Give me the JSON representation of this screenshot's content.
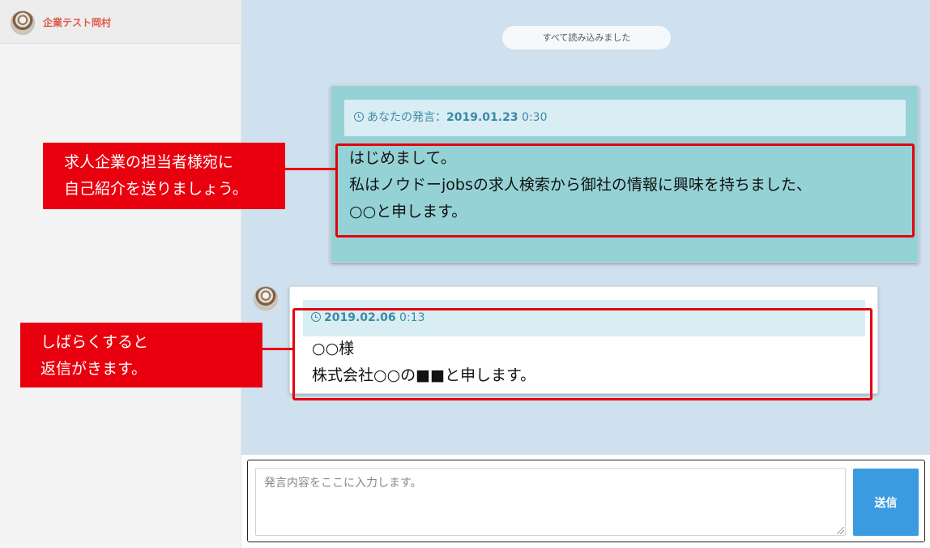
{
  "sidebar": {
    "company_name": "企業テスト岡村"
  },
  "chat": {
    "load_status": "すべて読み込みました",
    "messages": [
      {
        "author": "mine",
        "meta_prefix": "あなたの発言：",
        "date": "2019.01.23",
        "time": "0:30",
        "lines": [
          "はじめまして。",
          "私はノウドーjobsの求人検索から御社の情報に興味を持ちました、",
          "○○と申します。"
        ]
      },
      {
        "author": "company",
        "date": "2019.02.06",
        "time": "0:13",
        "lines": [
          "○○様",
          "株式会社○○の■■と申します。"
        ]
      }
    ]
  },
  "composer": {
    "placeholder": "発言内容をここに入力します。",
    "send_label": "送信"
  },
  "annotations": [
    {
      "lines": [
        "求人企業の担当者様宛に",
        "自己紹介を送りましょう。"
      ]
    },
    {
      "lines": [
        "しばらくすると",
        "返信がきます。"
      ]
    }
  ],
  "colors": {
    "annotation_red": "#e8000e",
    "company_name": "#e05848",
    "my_bubble": "#95d2d5",
    "chat_background": "#cfe0ee",
    "send_button": "#3a9be0",
    "meta_text": "#3d8aa6"
  }
}
